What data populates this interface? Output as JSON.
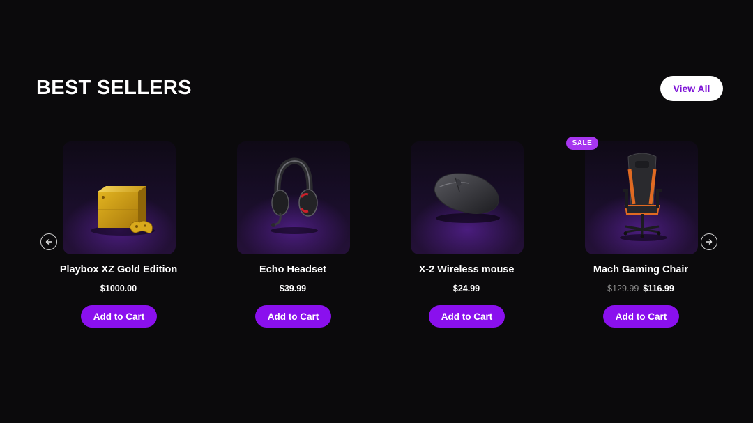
{
  "section": {
    "title": "BEST SELLERS",
    "view_all_label": "View All"
  },
  "carousel": {
    "prev_icon": "arrow-left-icon",
    "next_icon": "arrow-right-icon"
  },
  "products": [
    {
      "name": "Playbox XZ Gold Edition",
      "price": "$1000.00",
      "cta": "Add to Cart",
      "image": "gold-console-image"
    },
    {
      "name": "Echo Headset",
      "price": "$39.99",
      "cta": "Add to Cart",
      "image": "headset-image"
    },
    {
      "name": "X-2 Wireless mouse",
      "price": "$24.99",
      "cta": "Add to Cart",
      "image": "mouse-image"
    },
    {
      "name": "Mach Gaming Chair",
      "old_price": "$129.99",
      "price": "$116.99",
      "badge": "SALE",
      "cta": "Add to Cart",
      "image": "gaming-chair-image"
    }
  ],
  "colors": {
    "background": "#0b0a0c",
    "accent": "#8a10ee",
    "badge": "#a736f0",
    "view_all_text": "#7d12d6"
  }
}
